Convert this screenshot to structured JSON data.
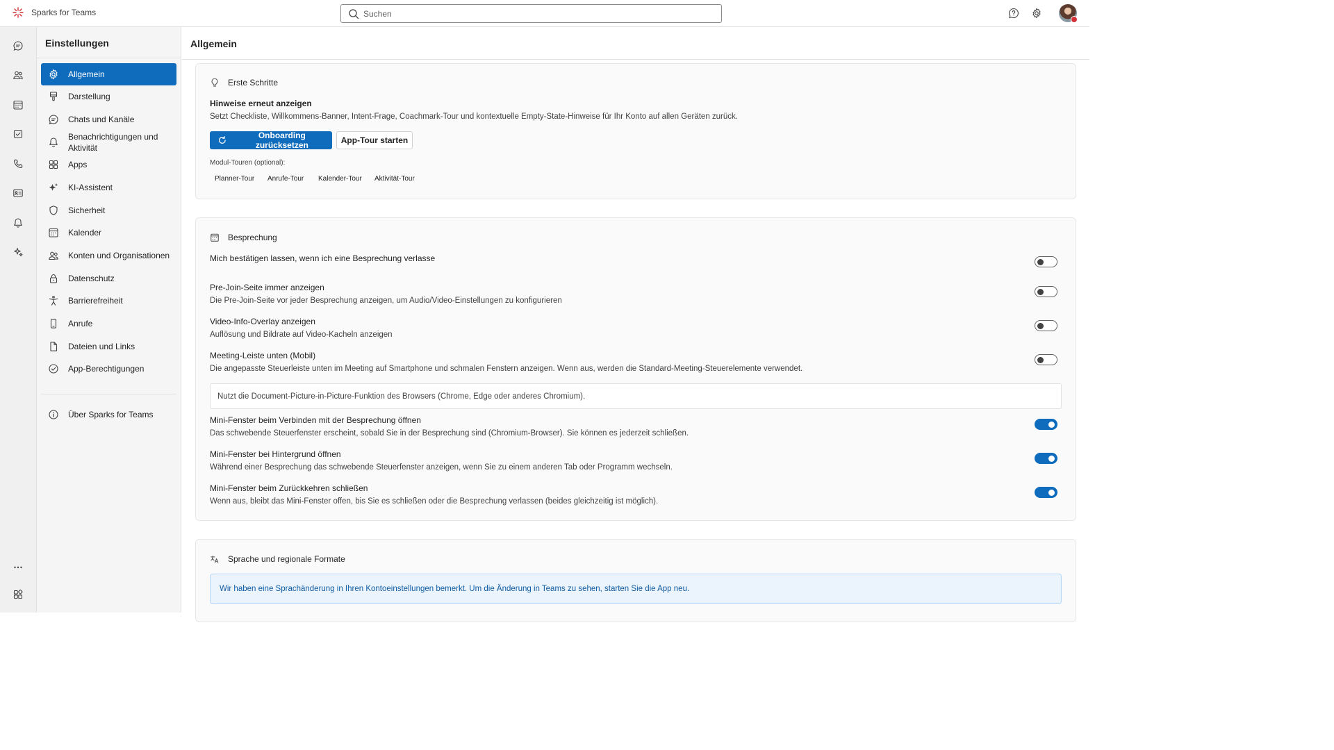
{
  "app": {
    "name": "Sparks for Teams"
  },
  "search": {
    "placeholder": "Suchen"
  },
  "settings": {
    "title": "Einstellungen",
    "nav": [
      {
        "label": "Allgemein",
        "icon": "gear-icon",
        "active": true
      },
      {
        "label": "Darstellung",
        "icon": "paintbrush-icon"
      },
      {
        "label": "Chats und Kanäle",
        "icon": "chat-icon"
      },
      {
        "label": "Benachrichtigungen und Aktivität",
        "icon": "bell-icon"
      },
      {
        "label": "Apps",
        "icon": "apps-icon"
      },
      {
        "label": "KI-Assistent",
        "icon": "sparkle-icon"
      },
      {
        "label": "Sicherheit",
        "icon": "shield-icon"
      },
      {
        "label": "Kalender",
        "icon": "calendar-icon"
      },
      {
        "label": "Konten und Organisationen",
        "icon": "people-icon"
      },
      {
        "label": "Datenschutz",
        "icon": "lock-icon"
      },
      {
        "label": "Barrierefreiheit",
        "icon": "accessibility-icon"
      },
      {
        "label": "Anrufe",
        "icon": "phone-icon"
      },
      {
        "label": "Dateien und Links",
        "icon": "document-icon"
      },
      {
        "label": "App-Berechtigungen",
        "icon": "checkmark-circle-icon"
      }
    ],
    "about": {
      "label": "Über Sparks for Teams",
      "icon": "info-icon"
    }
  },
  "main": {
    "title": "Allgemein",
    "erste_schritte": {
      "heading": "Erste Schritte",
      "hint_title": "Hinweise erneut anzeigen",
      "hint_desc": "Setzt Checkliste, Willkommens-Banner, Intent-Frage, Coachmark-Tour und kontextuelle Empty-State-Hinweise für Ihr Konto auf allen Geräten zurück.",
      "primary_button": "Onboarding zurücksetzen",
      "secondary_button": "App-Tour starten",
      "module_label": "Modul-Touren (optional):",
      "tours": [
        "Planner-Tour",
        "Anrufe-Tour",
        "Kalender-Tour",
        "Aktivität-Tour"
      ]
    },
    "besprechung": {
      "heading": "Besprechung",
      "settings": [
        {
          "title": "Mich bestätigen lassen, wenn ich eine Besprechung verlasse",
          "desc": "",
          "enabled": false
        },
        {
          "title": "Pre-Join-Seite immer anzeigen",
          "desc": "Die Pre-Join-Seite vor jeder Besprechung anzeigen, um Audio/Video-Einstellungen zu konfigurieren",
          "enabled": false
        },
        {
          "title": "Video-Info-Overlay anzeigen",
          "desc": "Auflösung und Bildrate auf Video-Kacheln anzeigen",
          "enabled": false
        },
        {
          "title": "Meeting-Leiste unten (Mobil)",
          "desc": "Die angepasste Steuerleiste unten im Meeting auf Smartphone und schmalen Fenstern anzeigen. Wenn aus, werden die Standard-Meeting-Steuerelemente verwendet.",
          "enabled": false
        }
      ],
      "pip_info": "Nutzt die Document-Picture-in-Picture-Funktion des Browsers (Chrome, Edge oder anderes Chromium).",
      "mini_settings": [
        {
          "title": "Mini-Fenster beim Verbinden mit der Besprechung öffnen",
          "desc": "Das schwebende Steuerfenster erscheint, sobald Sie in der Besprechung sind (Chromium-Browser). Sie können es jederzeit schließen.",
          "enabled": true
        },
        {
          "title": "Mini-Fenster bei Hintergrund öffnen",
          "desc": "Während einer Besprechung das schwebende Steuerfenster anzeigen, wenn Sie zu einem anderen Tab oder Programm wechseln.",
          "enabled": true
        },
        {
          "title": "Mini-Fenster beim Zurückkehren schließen",
          "desc": "Wenn aus, bleibt das Mini-Fenster offen, bis Sie es schließen oder die Besprechung verlassen (beides gleichzeitig ist möglich).",
          "enabled": true
        }
      ]
    },
    "sprache": {
      "heading": "Sprache und regionale Formate",
      "notice": "Wir haben eine Sprachänderung in Ihren Kontoeinstellungen bemerkt. Um die Änderung in Teams zu sehen, starten Sie die App neu."
    }
  },
  "colors": {
    "accent": "#0f6cbd",
    "brand": "#d13438",
    "notice_text": "#115ea3",
    "notice_bg": "#ebf3fc"
  }
}
